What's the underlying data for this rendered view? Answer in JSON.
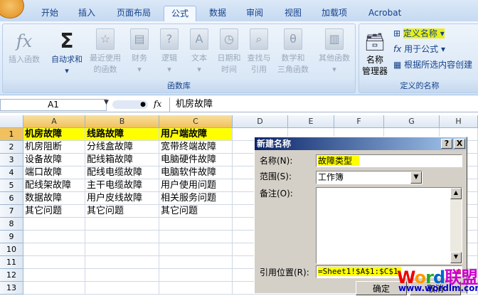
{
  "tabs": [
    "开始",
    "插入",
    "页面布局",
    "公式",
    "数据",
    "审阅",
    "视图",
    "加载项",
    "Acrobat"
  ],
  "ribbon": {
    "insert_function": "插入函数",
    "autosum": "自动求和",
    "buttons": [
      {
        "l1": "最近使用",
        "l2": "的函数"
      },
      {
        "l1": "财务",
        "l2": ""
      },
      {
        "l1": "逻辑",
        "l2": ""
      },
      {
        "l1": "文本",
        "l2": ""
      },
      {
        "l1": "日期和",
        "l2": "时间"
      },
      {
        "l1": "查找与",
        "l2": "引用"
      },
      {
        "l1": "数学和",
        "l2": "三角函数"
      },
      {
        "l1": "其他函数",
        "l2": ""
      }
    ],
    "group1": "函数库",
    "name_manager": {
      "l1": "名称",
      "l2": "管理器"
    },
    "define_name": "定义名称",
    "use_in_formula": "用于公式",
    "create_from_selection": "根据所选内容创建",
    "group2": "定义的名称"
  },
  "formula_bar": {
    "name_box": "A1",
    "fx": "fx",
    "content": "机房故障"
  },
  "columns": [
    "A",
    "B",
    "C",
    "D",
    "E",
    "F",
    "G",
    "H"
  ],
  "rows": [
    "1",
    "2",
    "3",
    "4",
    "5",
    "6",
    "7",
    "8",
    "9",
    "10",
    "11",
    "12",
    "13"
  ],
  "cells": [
    [
      "机房故障",
      "线路故障",
      "用户端故障"
    ],
    [
      "机房阻断",
      "分线盒故障",
      "宽带终端故障"
    ],
    [
      "设备故障",
      "配线箱故障",
      "电脑硬件故障"
    ],
    [
      "端口故障",
      "配线电缆故障",
      "电脑软件故障"
    ],
    [
      "配线架故障",
      "主干电缆故障",
      "用户使用问题"
    ],
    [
      "数据故障",
      "用户皮线故障",
      "相关服务问题"
    ],
    [
      "其它问题",
      "其它问题",
      "其它问题"
    ]
  ],
  "dialog": {
    "title": "新建名称",
    "help": "?",
    "close": "X",
    "name_label": "名称(N):",
    "name_value": "故障类型",
    "scope_label": "范围(S):",
    "scope_value": "工作簿",
    "comment_label": "备注(O):",
    "refers_label": "引用位置(R):",
    "refers_value": "=Sheet1!$A$1:$C$1",
    "ok": "确定",
    "cancel": "取消"
  },
  "watermark": {
    "brand": "Word联盟",
    "url": "www.wordlm.com"
  }
}
